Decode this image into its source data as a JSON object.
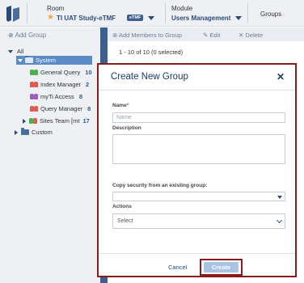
{
  "header": {
    "room_label": "Room",
    "room_value": "TI UAT Study-eTMF",
    "room_badge": "eTMF",
    "module_label": "Module",
    "module_value": "Users Management",
    "groups_label": "Groups"
  },
  "sidebar": {
    "add_group": "Add Group",
    "tree": [
      {
        "label": "All",
        "count": ""
      },
      {
        "label": "System",
        "count": ""
      },
      {
        "label": "General Query",
        "count": "10"
      },
      {
        "label": "Index Manager",
        "count": "2"
      },
      {
        "label": "myTi Access",
        "count": "8"
      },
      {
        "label": "Query Manager",
        "count": "8"
      },
      {
        "label": "Sites Team [mt",
        "count": "17"
      },
      {
        "label": "Custom",
        "count": ""
      }
    ]
  },
  "toolbar": {
    "add_members": "Add Members to Group",
    "edit": "Edit",
    "delete": "Delete",
    "selection": "1 - 10 of 10 (0 selected)"
  },
  "modal": {
    "title": "Create New Group",
    "name_label": "Name",
    "name_placeholder": "Name",
    "description_label": "Description",
    "copy_label": "Copy security from an existing group:",
    "actions_label": "Actions",
    "actions_value": "Select",
    "cancel": "Cancel",
    "create": "Create"
  },
  "colors": {
    "accent": "#3b5f8f",
    "highlight_outline": "#8b1a1a",
    "selected_row": "#5b8ac4"
  }
}
